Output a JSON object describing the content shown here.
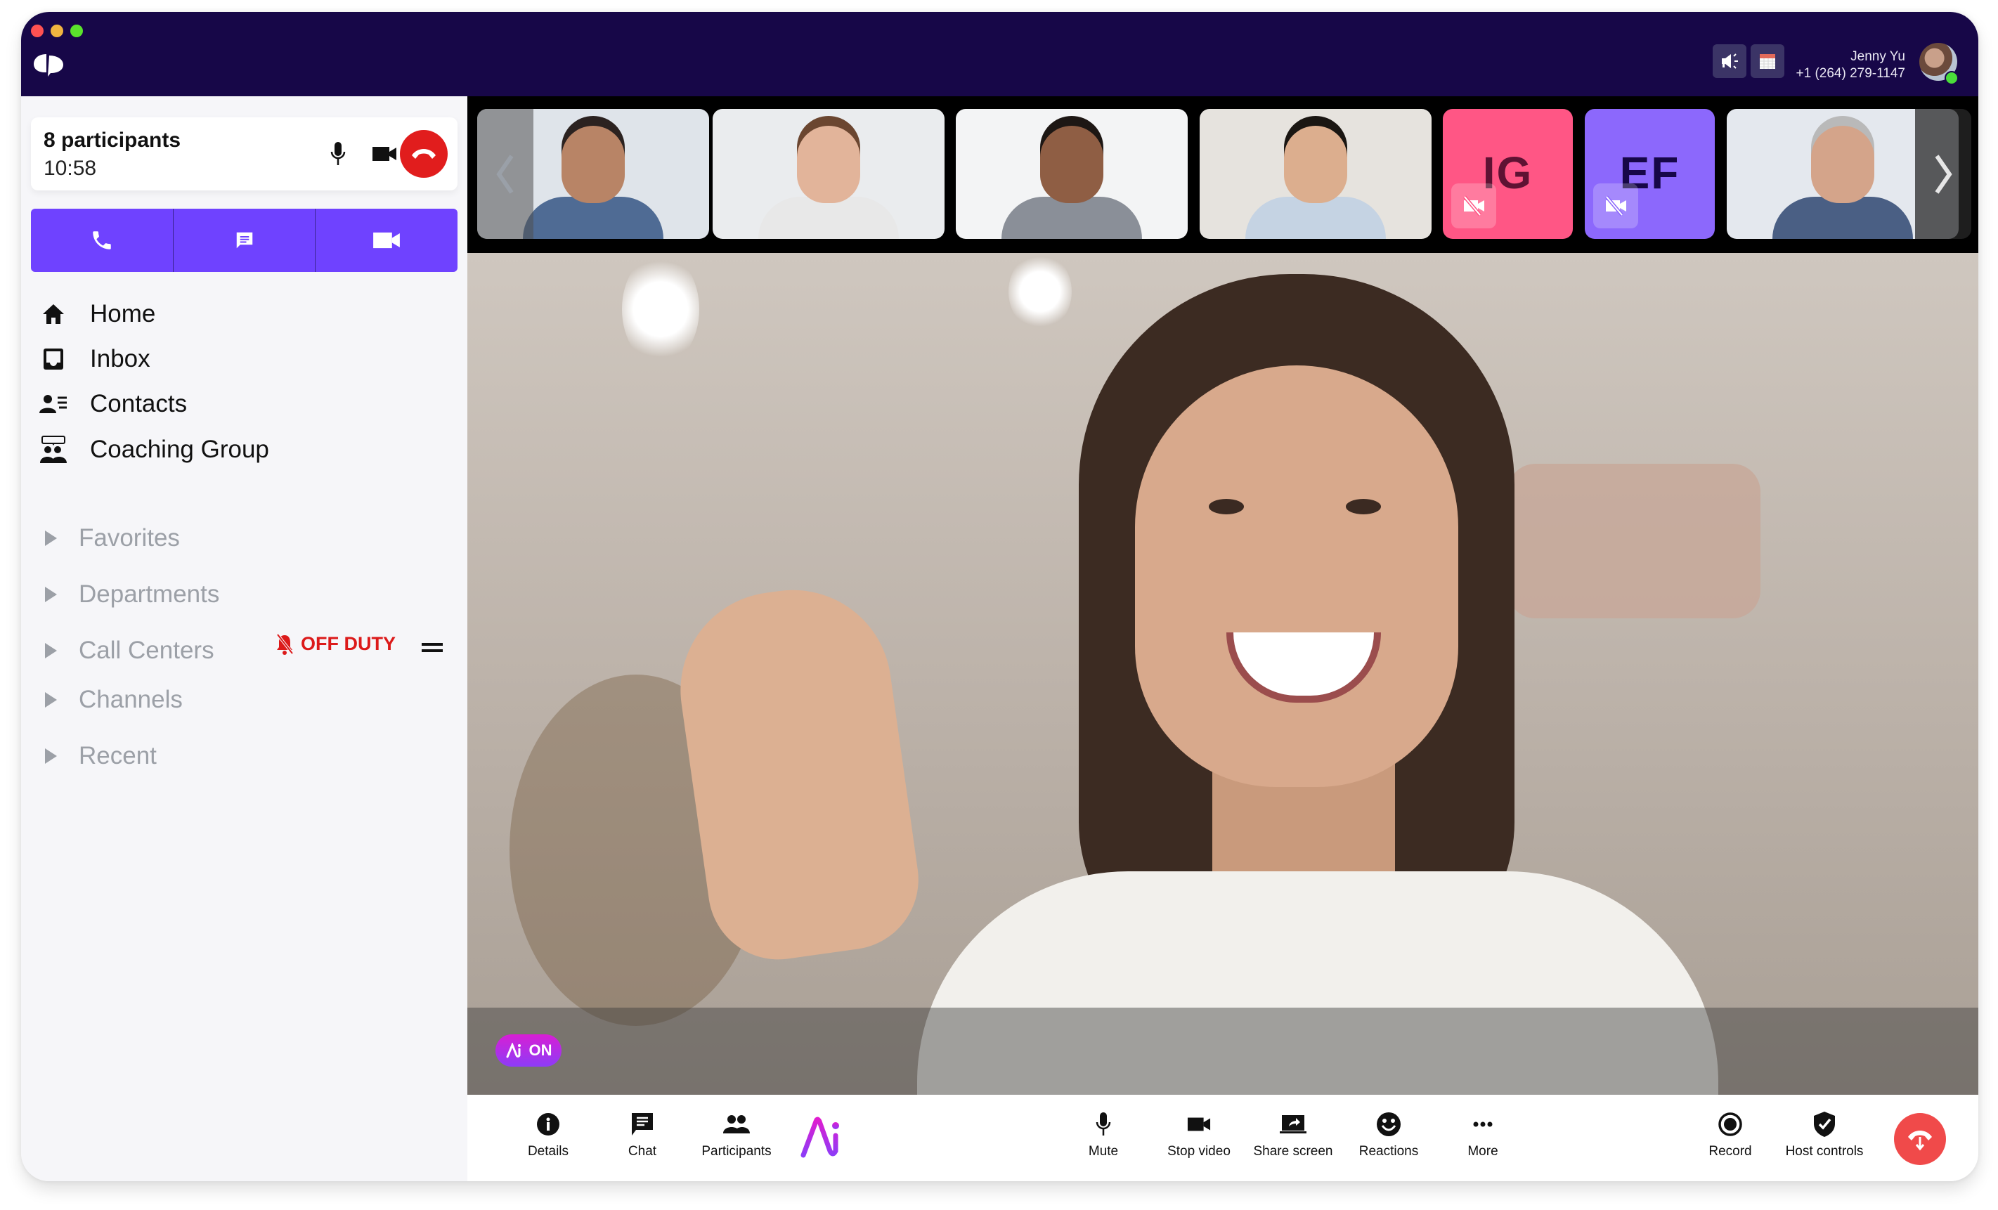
{
  "app": {
    "name": "Dialpad",
    "brand_color": "#6f42ff",
    "header_bg": "#170748"
  },
  "header": {
    "user_name": "Jenny Yu",
    "user_phone": "+1 (264) 279-1147",
    "icons": [
      "megaphone-icon",
      "calendar-icon"
    ],
    "presence": "online"
  },
  "call_card": {
    "title": "8 participants",
    "duration": "10:58"
  },
  "nav": {
    "items": [
      {
        "label": "Home",
        "icon": "home-icon"
      },
      {
        "label": "Inbox",
        "icon": "inbox-icon"
      },
      {
        "label": "Contacts",
        "icon": "contacts-icon"
      },
      {
        "label": "Coaching Group",
        "icon": "coaching-group-icon"
      }
    ],
    "sections": [
      {
        "label": "Favorites"
      },
      {
        "label": "Departments"
      },
      {
        "label": "Call Centers"
      },
      {
        "label": "Channels"
      },
      {
        "label": "Recent"
      }
    ],
    "call_center_status": "OFF DUTY"
  },
  "filmstrip": {
    "tiles": [
      {
        "type": "video",
        "skin": "#b88466",
        "hair": "#2b2220",
        "shirt": "#4f6b94",
        "bg": "#dfe4ea"
      },
      {
        "type": "video",
        "skin": "#e2b49a",
        "hair": "#6b4630",
        "shirt": "#e8e8e8",
        "bg": "#eaecee"
      },
      {
        "type": "video",
        "skin": "#8f5e44",
        "hair": "#1d1714",
        "shirt": "#8a8f98",
        "bg": "#f3f4f5"
      },
      {
        "type": "video",
        "skin": "#dcae8e",
        "hair": "#1a1612",
        "shirt": "#c5d3e3",
        "bg": "#e6e3de"
      },
      {
        "type": "avatar",
        "initials": "IG",
        "bg": "#ff5685",
        "fg": "#5e1233",
        "camera": "off"
      },
      {
        "type": "avatar",
        "initials": "EF",
        "bg": "#8c68fc",
        "fg": "#170748",
        "camera": "off"
      },
      {
        "type": "video",
        "skin": "#d4a48a",
        "hair": "#b9b9b9",
        "shirt": "#4a5f84",
        "bg": "#e4e8ee"
      }
    ]
  },
  "main_video": {
    "ai_badge": "ON"
  },
  "toolbar": {
    "left": [
      {
        "label": "Details",
        "icon": "info-icon"
      },
      {
        "label": "Chat",
        "icon": "chat-icon"
      },
      {
        "label": "Participants",
        "icon": "participants-icon"
      }
    ],
    "center": [
      {
        "label": "Mute",
        "icon": "microphone-icon"
      },
      {
        "label": "Stop video",
        "icon": "video-camera-icon"
      },
      {
        "label": "Share screen",
        "icon": "share-screen-icon"
      },
      {
        "label": "Reactions",
        "icon": "smiley-icon"
      },
      {
        "label": "More",
        "icon": "more-icon"
      }
    ],
    "right": [
      {
        "label": "Record",
        "icon": "record-icon"
      },
      {
        "label": "Host controls",
        "icon": "shield-check-icon"
      }
    ]
  }
}
